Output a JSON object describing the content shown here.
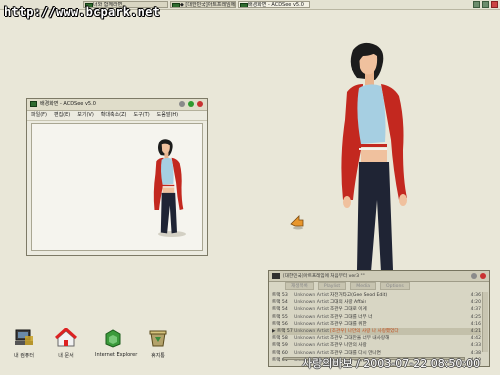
{
  "watermark": "http://www.bcpark.net",
  "taskbar": {
    "items": [
      {
        "label": "너와 함께라면"
      },
      {
        "label": "◆ [대한민국]아트프레임에"
      },
      {
        "label": "배경화면 - ACDSee v5.0"
      }
    ],
    "tray_icons": [
      "folder-icon",
      "network-icon",
      "close-icon"
    ]
  },
  "app_window": {
    "title": "배경화면 - ACDSee v5.0",
    "menu": [
      "파일(F)",
      "편집(E)",
      "보기(V)",
      "확대축소(Z)",
      "도구(T)",
      "도움말(H)"
    ]
  },
  "desktop_icons": [
    {
      "label": "내 컴퓨터",
      "icon": "computer-icon"
    },
    {
      "label": "내 문서",
      "icon": "documents-icon"
    },
    {
      "label": "Internet Explorer",
      "icon": "internet-explorer-icon"
    },
    {
      "label": "휴지통",
      "icon": "recycle-bin-icon"
    }
  ],
  "player": {
    "title": "[대한민국]아트프레임에 처음부터 ver3 \"\"",
    "tabs": [
      "재생목록",
      "Playlist",
      "Media",
      "Options"
    ],
    "rows": [
      {
        "num": "트랙 53",
        "artist": "Unknown Artist",
        "title": "자전거타고(Gee Seod Edit)",
        "dur": "4:36",
        "current": false
      },
      {
        "num": "트랙 54",
        "artist": "Unknown Artist",
        "title": "그대의 사랑 Affair",
        "dur": "4:20",
        "current": false
      },
      {
        "num": "트랙 54",
        "artist": "Unknown Artist",
        "title": "조관우 그대로 이게",
        "dur": "4:37",
        "current": false
      },
      {
        "num": "트랙 55",
        "artist": "Unknown Artist",
        "title": "조관우 그대를 너무 너",
        "dur": "4:25",
        "current": false
      },
      {
        "num": "트랙 56",
        "artist": "Unknown Artist",
        "title": "조관우 그대를 위한",
        "dur": "4:16",
        "current": false
      },
      {
        "num": "▶ 트랙 57",
        "artist": "Unknown Artist",
        "title": "[조관우] 나만의 사랑 나 사랑했었다",
        "dur": "4:21",
        "current": true
      },
      {
        "num": "트랙 58",
        "artist": "Unknown Artist",
        "title": "조관우 그대만을 너무 내사랑해",
        "dur": "4:42",
        "current": false
      },
      {
        "num": "트랙 59",
        "artist": "Unknown Artist",
        "title": "조관우 나만의 사랑",
        "dur": "4:33",
        "current": false
      },
      {
        "num": "트랙 60",
        "artist": "Unknown Artist",
        "title": "조관우 그대를 다시 만나면",
        "dur": "4:38",
        "current": false
      },
      {
        "num": "트랙 61",
        "artist": "Unknown Artist",
        "title": "조관우 꿈에 그대를",
        "dur": "4:19",
        "current": false
      }
    ]
  },
  "timestamp": "사랑의바보 / 2003-07-22 08:50:00"
}
